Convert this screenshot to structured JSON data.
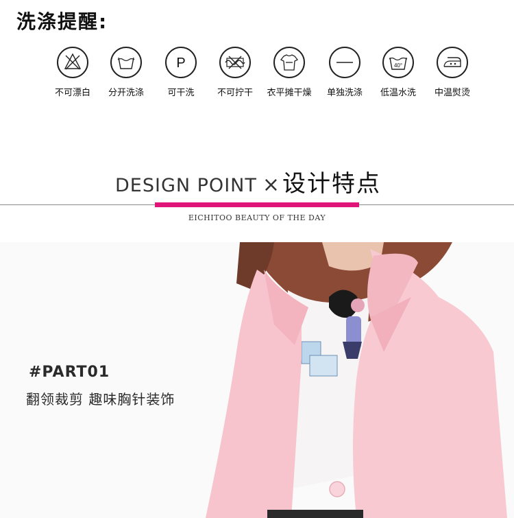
{
  "wash": {
    "title": "洗涤提醒:",
    "items": [
      {
        "label": "不可漂白",
        "icon": "no-bleach-icon"
      },
      {
        "label": "分开洗涤",
        "icon": "wash-separately-icon"
      },
      {
        "label": "可干洗",
        "icon": "dry-clean-icon",
        "symbol": "P"
      },
      {
        "label": "不可拧干",
        "icon": "no-wring-icon"
      },
      {
        "label": "衣平摊干燥",
        "icon": "dry-flat-icon"
      },
      {
        "label": "单独洗涤",
        "icon": "wash-alone-icon"
      },
      {
        "label": "低温水洗",
        "icon": "low-temp-wash-icon",
        "symbol": "40°"
      },
      {
        "label": "中温熨烫",
        "icon": "medium-iron-icon"
      }
    ]
  },
  "design": {
    "title_en": "DESIGN POINT",
    "separator": "×",
    "title_cn": "设计特点",
    "subtitle": "EICHITOO  BEAUTY OF THE DAY",
    "accent_color": "#e0157a"
  },
  "feature": {
    "tag": "#PART01",
    "description": "翻领裁剪 趣味胸针装饰",
    "jacket_color": "#f8c9d1"
  }
}
